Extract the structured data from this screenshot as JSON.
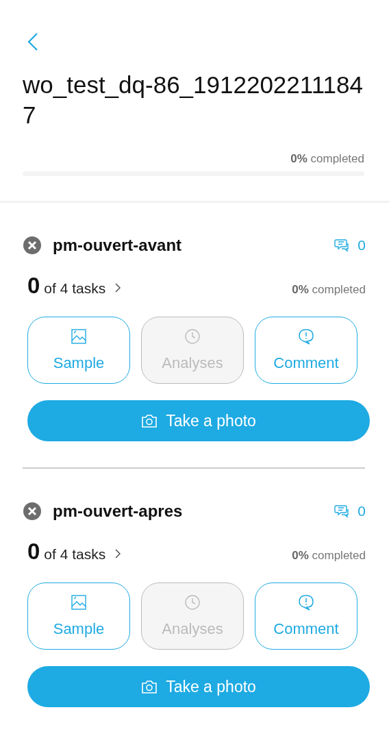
{
  "header": {
    "title": "wo_test_dq-86_19122022111847",
    "progress_text": "**0%** completed",
    "level": 0
  },
  "sections": [
    {
      "name": "pm-ouvert-avant",
      "comments": "0",
      "done": "0",
      "tasks": "of 4 tasks",
      "progress_text": "**0%** completed",
      "actions": [
        {
          "kind": "image",
          "label": "Sample",
          "disabled": false
        },
        {
          "kind": "clock",
          "label": "Analyses",
          "disabled": true
        },
        {
          "kind": "comment",
          "label": "Comment",
          "disabled": false
        }
      ],
      "photo": "Take a photo"
    },
    {
      "name": "pm-ouvert-apres",
      "comments": "0",
      "done": "0",
      "tasks": "of 4 tasks",
      "progress_text": "**0%** completed",
      "actions": [
        {
          "kind": "image",
          "label": "Sample",
          "disabled": false
        },
        {
          "kind": "clock",
          "label": "Analyses",
          "disabled": true
        },
        {
          "kind": "comment",
          "label": "Comment",
          "disabled": false
        }
      ],
      "photo": "Take a photo"
    }
  ]
}
